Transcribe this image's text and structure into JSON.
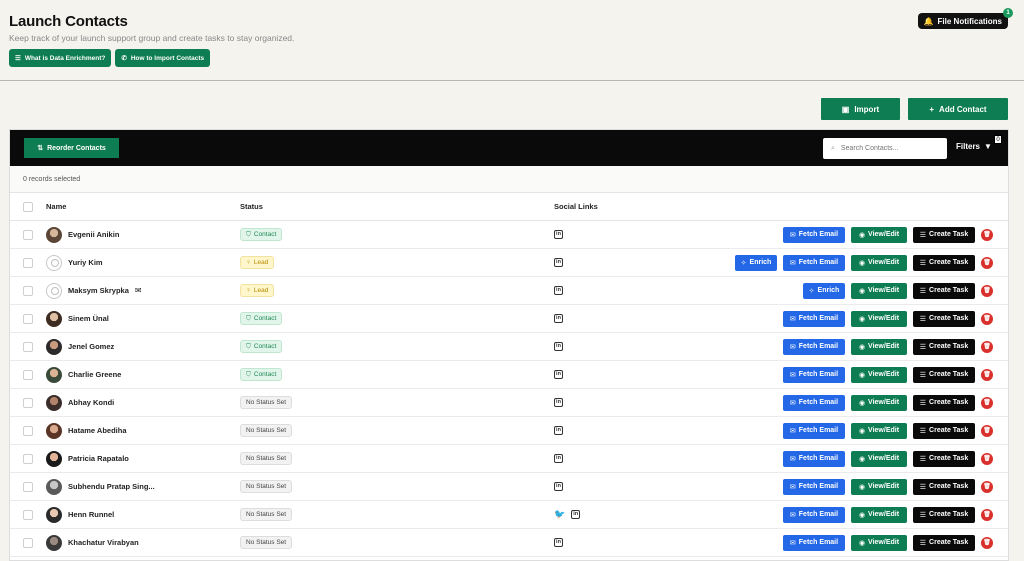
{
  "header": {
    "title": "Launch Contacts",
    "subtitle": "Keep track of your launch support group and create tasks to stay organized.",
    "help_enrichment": "What is Data Enrichment?",
    "help_import": "How to Import Contacts",
    "notifications_label": "File Notifications",
    "notifications_count": "1"
  },
  "actions": {
    "import_label": "Import",
    "add_label": "Add Contact"
  },
  "toolbar": {
    "reorder_label": "Reorder Contacts",
    "search_placeholder": "Search Contacts...",
    "filters_label": "Filters",
    "filters_count": "0"
  },
  "selection": "0 records selected",
  "columns": {
    "name": "Name",
    "status": "Status",
    "social": "Social Links"
  },
  "buttons": {
    "fetch": "Fetch Email",
    "enrich": "Enrich",
    "view": "View/Edit",
    "task": "Create Task"
  },
  "colors": {
    "green": "#0f7d54",
    "blue": "#2468e8",
    "black": "#0a0a0a",
    "red": "#d9302c"
  },
  "rows": [
    {
      "name": "Evgenii Anikin",
      "status": "Contact",
      "social": [
        "linkedin"
      ],
      "actions": [
        "fetch",
        "view",
        "task",
        "delete"
      ]
    },
    {
      "name": "Yuriy Kim",
      "status": "Lead",
      "social": [
        "linkedin"
      ],
      "actions": [
        "enrich",
        "fetch",
        "view",
        "task",
        "delete"
      ]
    },
    {
      "name": "Maksym Skrypka",
      "status": "Lead",
      "social": [
        "linkedin"
      ],
      "actions": [
        "enrich",
        "view",
        "task",
        "delete"
      ]
    },
    {
      "name": "Sinem Ünal",
      "status": "Contact",
      "social": [
        "linkedin"
      ],
      "actions": [
        "fetch",
        "view",
        "task",
        "delete"
      ]
    },
    {
      "name": "Jenel Gomez",
      "status": "Contact",
      "social": [
        "linkedin"
      ],
      "actions": [
        "fetch",
        "view",
        "task",
        "delete"
      ]
    },
    {
      "name": "Charlie Greene",
      "status": "Contact",
      "social": [
        "linkedin"
      ],
      "actions": [
        "fetch",
        "view",
        "task",
        "delete"
      ]
    },
    {
      "name": "Abhay Kondi",
      "status": "No Status Set",
      "social": [
        "linkedin"
      ],
      "actions": [
        "fetch",
        "view",
        "task",
        "delete"
      ]
    },
    {
      "name": "Hatame Abediha",
      "status": "No Status Set",
      "social": [
        "linkedin"
      ],
      "actions": [
        "fetch",
        "view",
        "task",
        "delete"
      ]
    },
    {
      "name": "Patricia Rapatalo",
      "status": "No Status Set",
      "social": [
        "linkedin"
      ],
      "actions": [
        "fetch",
        "view",
        "task",
        "delete"
      ]
    },
    {
      "name": "Subhendu Pratap Sing...",
      "status": "No Status Set",
      "social": [
        "linkedin"
      ],
      "actions": [
        "fetch",
        "view",
        "task",
        "delete"
      ]
    },
    {
      "name": "Henn Runnel",
      "status": "No Status Set",
      "social": [
        "twitter",
        "linkedin"
      ],
      "actions": [
        "fetch",
        "view",
        "task",
        "delete"
      ]
    },
    {
      "name": "Khachatur Virabyan",
      "status": "No Status Set",
      "social": [
        "linkedin"
      ],
      "actions": [
        "fetch",
        "view",
        "task",
        "delete"
      ]
    }
  ]
}
